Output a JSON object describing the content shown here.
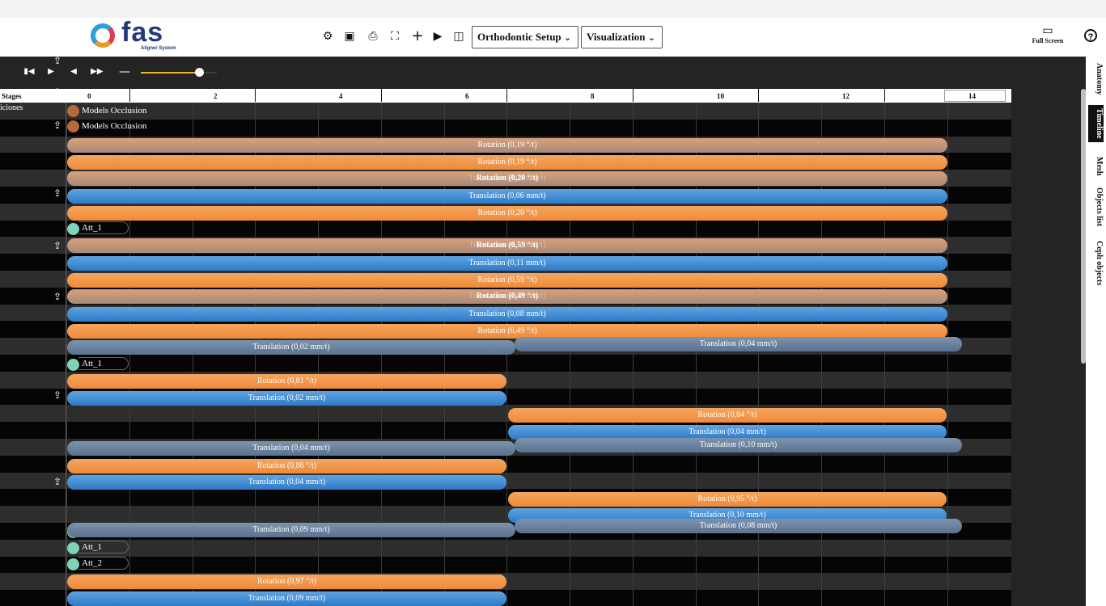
{
  "app": {
    "logo_text": "fas",
    "logo_subtitle": "Aligner System"
  },
  "toolbar": {
    "icons": [
      "gear-icon",
      "image-icon",
      "print-icon",
      "expand-icon",
      "plus-icon",
      "play-icon",
      "layout-icon"
    ],
    "dropdown_setup": "Orthodontic Setup",
    "dropdown_visualization": "Visualization",
    "fullscreen_label": "Full Screen",
    "help_icon": "help-icon"
  },
  "side_tabs": [
    "Anatomy",
    "Timeline",
    "Mesh",
    "Objects list",
    "Ceph objects"
  ],
  "side_tab_active": "Timeline",
  "player": {
    "slider_value": 0.85
  },
  "timeline": {
    "stages_label": "Stages",
    "row_header_label": "iciones",
    "stage_numbers": [
      "0",
      "2",
      "4",
      "6",
      "8",
      "10",
      "12",
      "14"
    ],
    "current_stage": "14",
    "colors": {
      "rotation": "#f0903e",
      "translation": "#3a86d0",
      "model_dot": "#b46a3c",
      "att_dot": "#7fd4b8"
    },
    "objects": {
      "models_occlusion_1": "Models Occlusion",
      "models_occlusion_2": "Models Occlusion",
      "att_a": "Att_1",
      "att_b": "Att_1",
      "att_c_faded": "Att_1",
      "att_d": "Att_1",
      "att_e_faded": "Att_2",
      "att_f": "Att_1",
      "att_g": "Att_2"
    },
    "bars": {
      "b1": "Rotation (0,19 °/t)",
      "b2": "Rotation (0,19 °/t)",
      "b3": "Rotation (0,20 °/t)",
      "b3_ghost": "Translation (0,06 mm/t)",
      "b4": "Translation (0,06 mm/t)",
      "b5": "Rotation (0,20 °/t)",
      "b6": "Rotation (0,59 °/t)",
      "b6_ghost": "Translation (0,11 mm/t)",
      "b7": "Translation (0,11 mm/t)",
      "b8": "Rotation (0,59 °/t)",
      "b9": "Rotation (0,49 °/t)",
      "b9_ghost": "Translation (0,08 mm/t)",
      "b10": "Translation (0,08 mm/t)",
      "b11": "Rotation (0,49 °/t)",
      "b12": "Translation (0,02 mm/t)",
      "b13": "Translation (0,04 mm/t)",
      "b14": "Rotation (0,81 °/t)",
      "b15": "Translation (0,02 mm/t)",
      "b16": "Rotation (0,84 °/t)",
      "b17": "Translation (0,04 mm/t)",
      "b18": "Translation (0,04 mm/t)",
      "b19": "Translation (0,10 mm/t)",
      "b20": "Rotation (0,86 °/t)",
      "b21": "Translation (0,04 mm/t)",
      "b22": "Rotation (0,95 °/t)",
      "b23": "Translation (0,10 mm/t)",
      "b24": "Translation (0,09 mm/t)",
      "b25": "Translation (0,08 mm/t)",
      "b26": "Rotation (0,97 °/t)",
      "b27": "Translation (0,09 mm/t)"
    }
  }
}
